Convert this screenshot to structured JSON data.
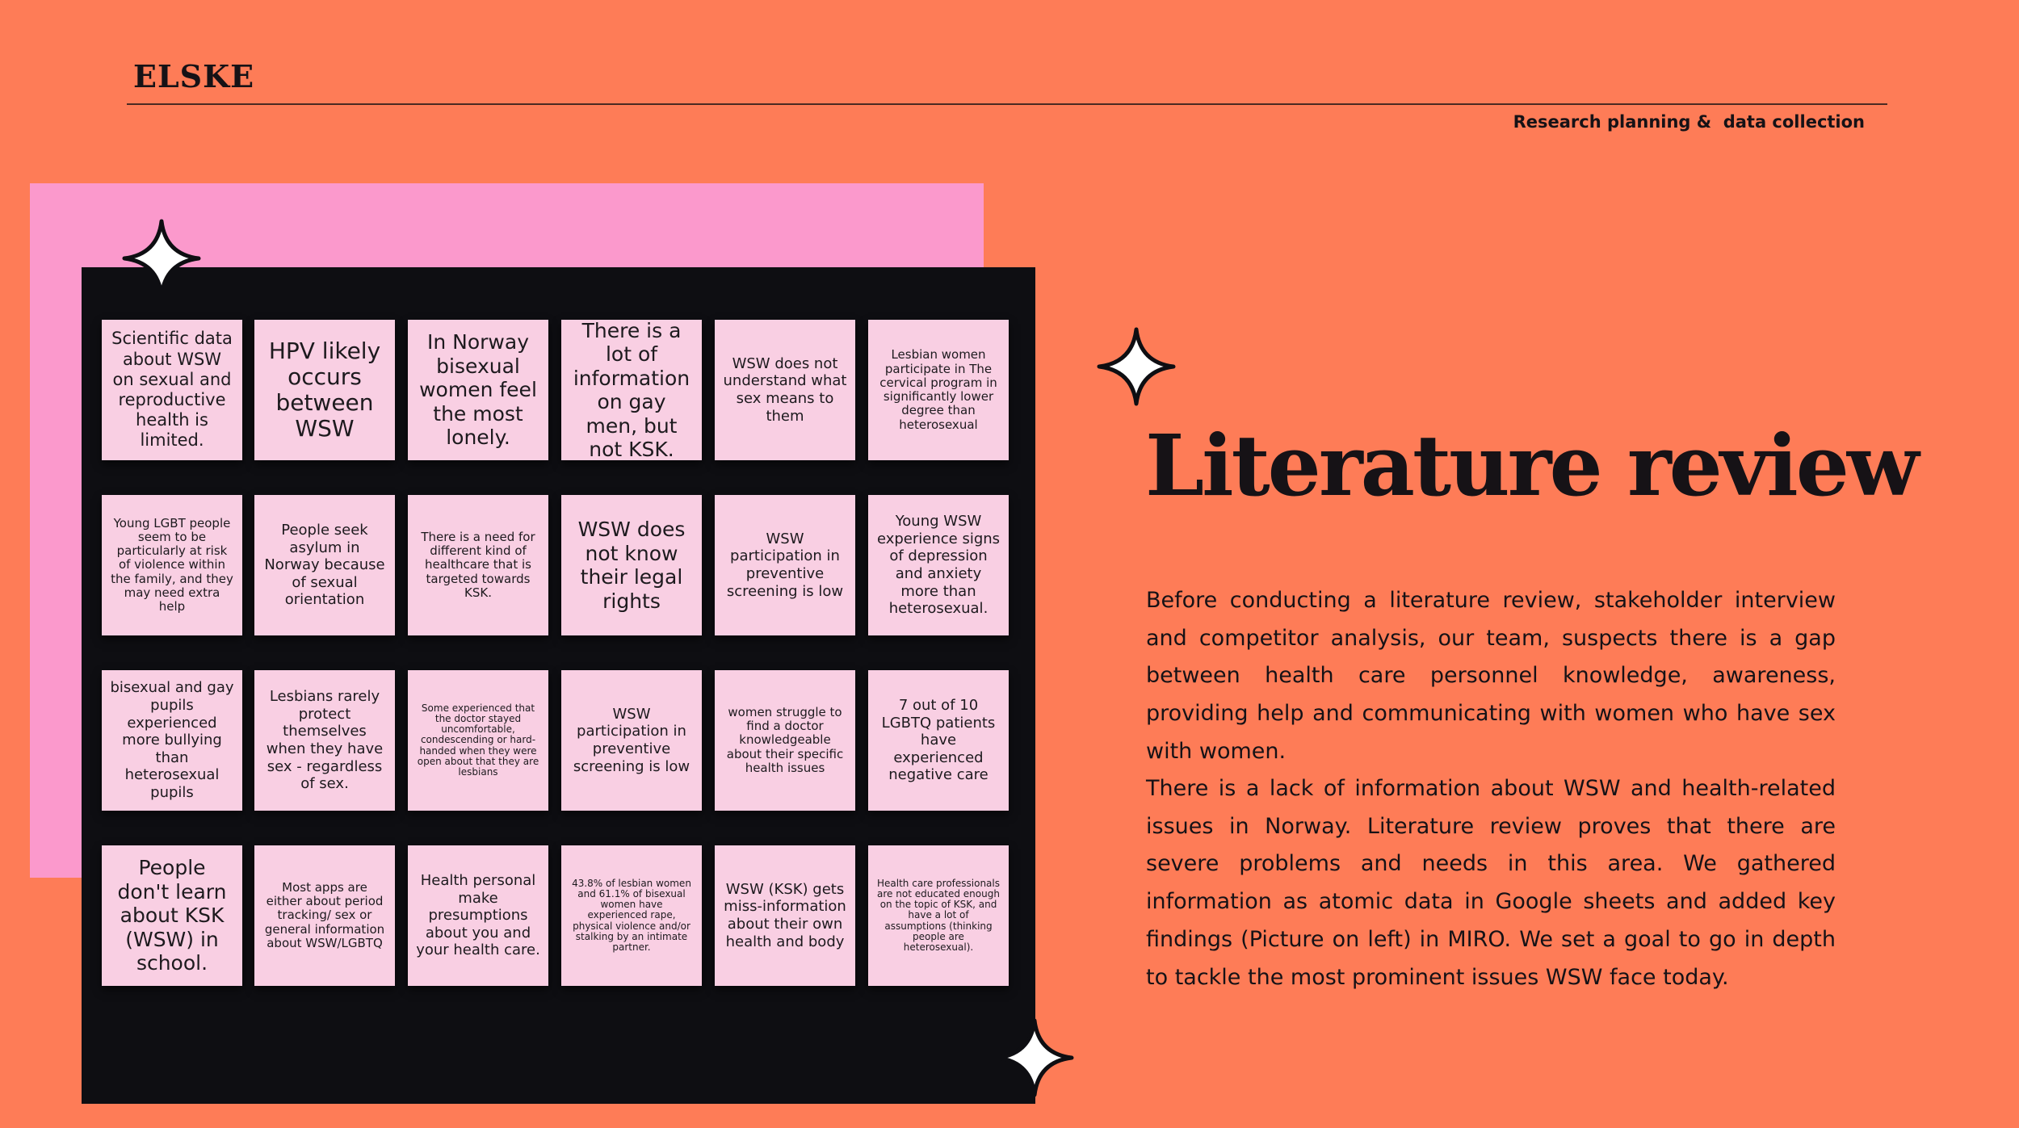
{
  "header": {
    "brand": "ELSKE",
    "section": "Research planning &  data collection"
  },
  "notes": [
    "Scientific data about WSW on sexual and reproductive health is limited.",
    "HPV likely occurs between WSW",
    "In Norway bisexual women feel the most lonely.",
    "There is a lot of information on gay men, but not KSK.",
    "WSW does not understand what sex means to them",
    "Lesbian women participate in The cervical program in significantly lower degree than heterosexual",
    "Young LGBT people seem to be particularly at risk of violence within the family, and they may need extra help",
    "People seek asylum in Norway because of sexual orientation",
    "There is a need for different kind of healthcare that is targeted towards KSK.",
    "WSW does not know their legal rights",
    "WSW participation in preventive screening is low",
    "Young WSW experience signs of depression and anxiety more than heterosexual.",
    "bisexual and gay pupils experienced more bullying than heterosexual pupils",
    "Lesbians rarely protect themselves when they have sex - regardless of sex.",
    "Some experienced that the doctor stayed uncomfortable, condescending or hard-handed when they were open about that they are lesbians",
    "WSW participation in preventive screening is low",
    "women struggle to find a doctor knowledgeable about their specific health issues",
    "7 out of 10 LGBTQ patients have experienced negative care",
    "People don't learn about KSK (WSW) in school.",
    "Most apps are either about period tracking/ sex or general information about WSW/LGBTQ",
    "Health personal make presumptions about you and your health care.",
    "43.8% of lesbian women and 61.1% of bisexual women have experienced rape, physical violence and/or stalking by an intimate partner.",
    "WSW (KSK) gets miss-information about their own health and body",
    "Health care professionals are not educated enough on the topic of KSK, and have a lot of assumptions (thinking people are heterosexual)."
  ],
  "main": {
    "title": "Literature review",
    "paragraph1": "Before conducting a literature review, stakeholder interview and competitor analysis, our team, suspects there is a gap between health care personnel knowledge, awareness, providing help and communicating with women who have sex with women.",
    "paragraph2": "There is a lack of information about WSW and health-related issues in Norway. Literature review proves that there are severe problems and needs in this area. We gathered information as atomic data in Google sheets and added key findings (Picture on left) in MIRO. We set a goal to go in depth to tackle the most prominent issues WSW face today."
  },
  "colors": {
    "background": "#fe7c57",
    "pink_panel": "#fb99cc",
    "board": "#0e0e12",
    "sticky_note": "#f9cfe3",
    "text": "#161216"
  },
  "icons": [
    "sparkle-icon"
  ]
}
